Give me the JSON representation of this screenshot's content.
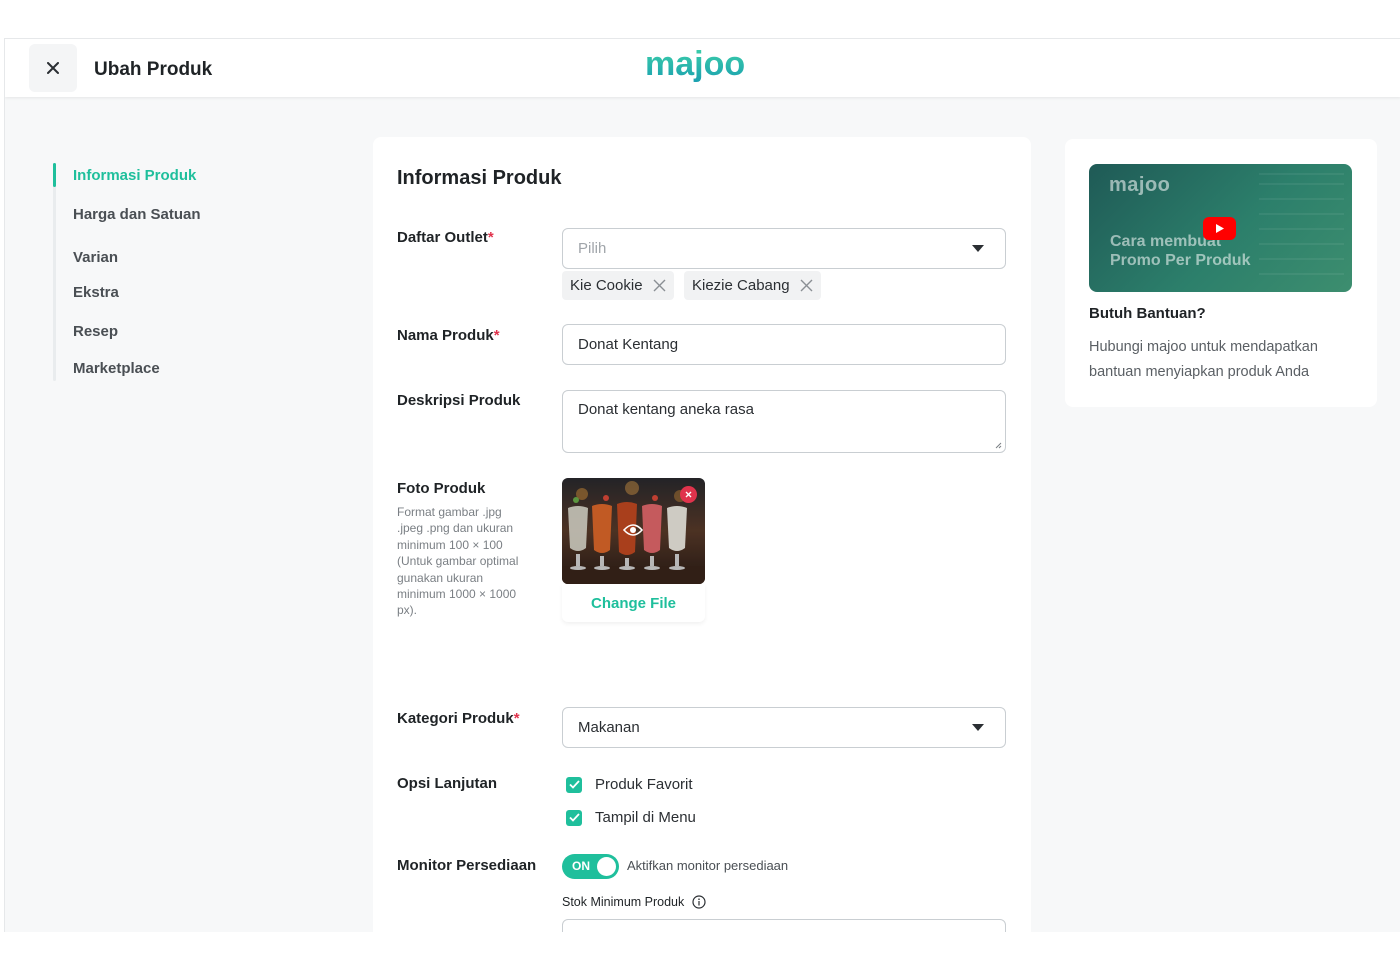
{
  "header": {
    "close_icon": "close-icon",
    "title": "Ubah Produk",
    "logo_text": "majoo"
  },
  "sidenav": {
    "items": [
      {
        "label": "Informasi Produk",
        "active": true
      },
      {
        "label": "Harga dan Satuan",
        "active": false
      },
      {
        "label": "Varian",
        "active": false
      },
      {
        "label": "Ekstra",
        "active": false
      },
      {
        "label": "Resep",
        "active": false
      },
      {
        "label": "Marketplace",
        "active": false
      }
    ]
  },
  "form": {
    "title": "Informasi Produk",
    "outlet": {
      "label": "Daftar Outlet",
      "required_mark": "*",
      "placeholder": "Pilih",
      "chips": [
        "Kie Cookie",
        "Kiezie Cabang"
      ]
    },
    "name": {
      "label": "Nama Produk",
      "required_mark": "*",
      "value": "Donat Kentang"
    },
    "description": {
      "label": "Deskripsi Produk",
      "value": "Donat kentang aneka rasa"
    },
    "photo": {
      "label": "Foto Produk",
      "hint": "Format gambar .jpg .jpeg .png dan ukuran minimum 100 × 100 (Untuk gambar optimal gunakan ukuran minimum 1000 × 1000 px).",
      "change_label": "Change File"
    },
    "category": {
      "label": "Kategori Produk",
      "required_mark": "*",
      "value": "Makanan"
    },
    "options": {
      "label": "Opsi Lanjutan",
      "items": [
        {
          "label": "Produk Favorit",
          "checked": true
        },
        {
          "label": "Tampil di Menu",
          "checked": true
        }
      ]
    },
    "inventory": {
      "label": "Monitor Persediaan",
      "toggle_label": "ON",
      "toggle_on": true,
      "toggle_text": "Aktifkan monitor persediaan",
      "min_stock_label": "Stok Minimum Produk"
    }
  },
  "help": {
    "video_logo": "majoo",
    "video_title_line1": "Cara membuat",
    "video_title_line2": "Promo Per Produk",
    "title": "Butuh Bantuan?",
    "text": "Hubungi majoo untuk mendapatkan bantuan menyiapkan produk Anda"
  },
  "colors": {
    "accent": "#1fbf9c",
    "required": "#e0334c",
    "youtube": "#ff0000"
  }
}
